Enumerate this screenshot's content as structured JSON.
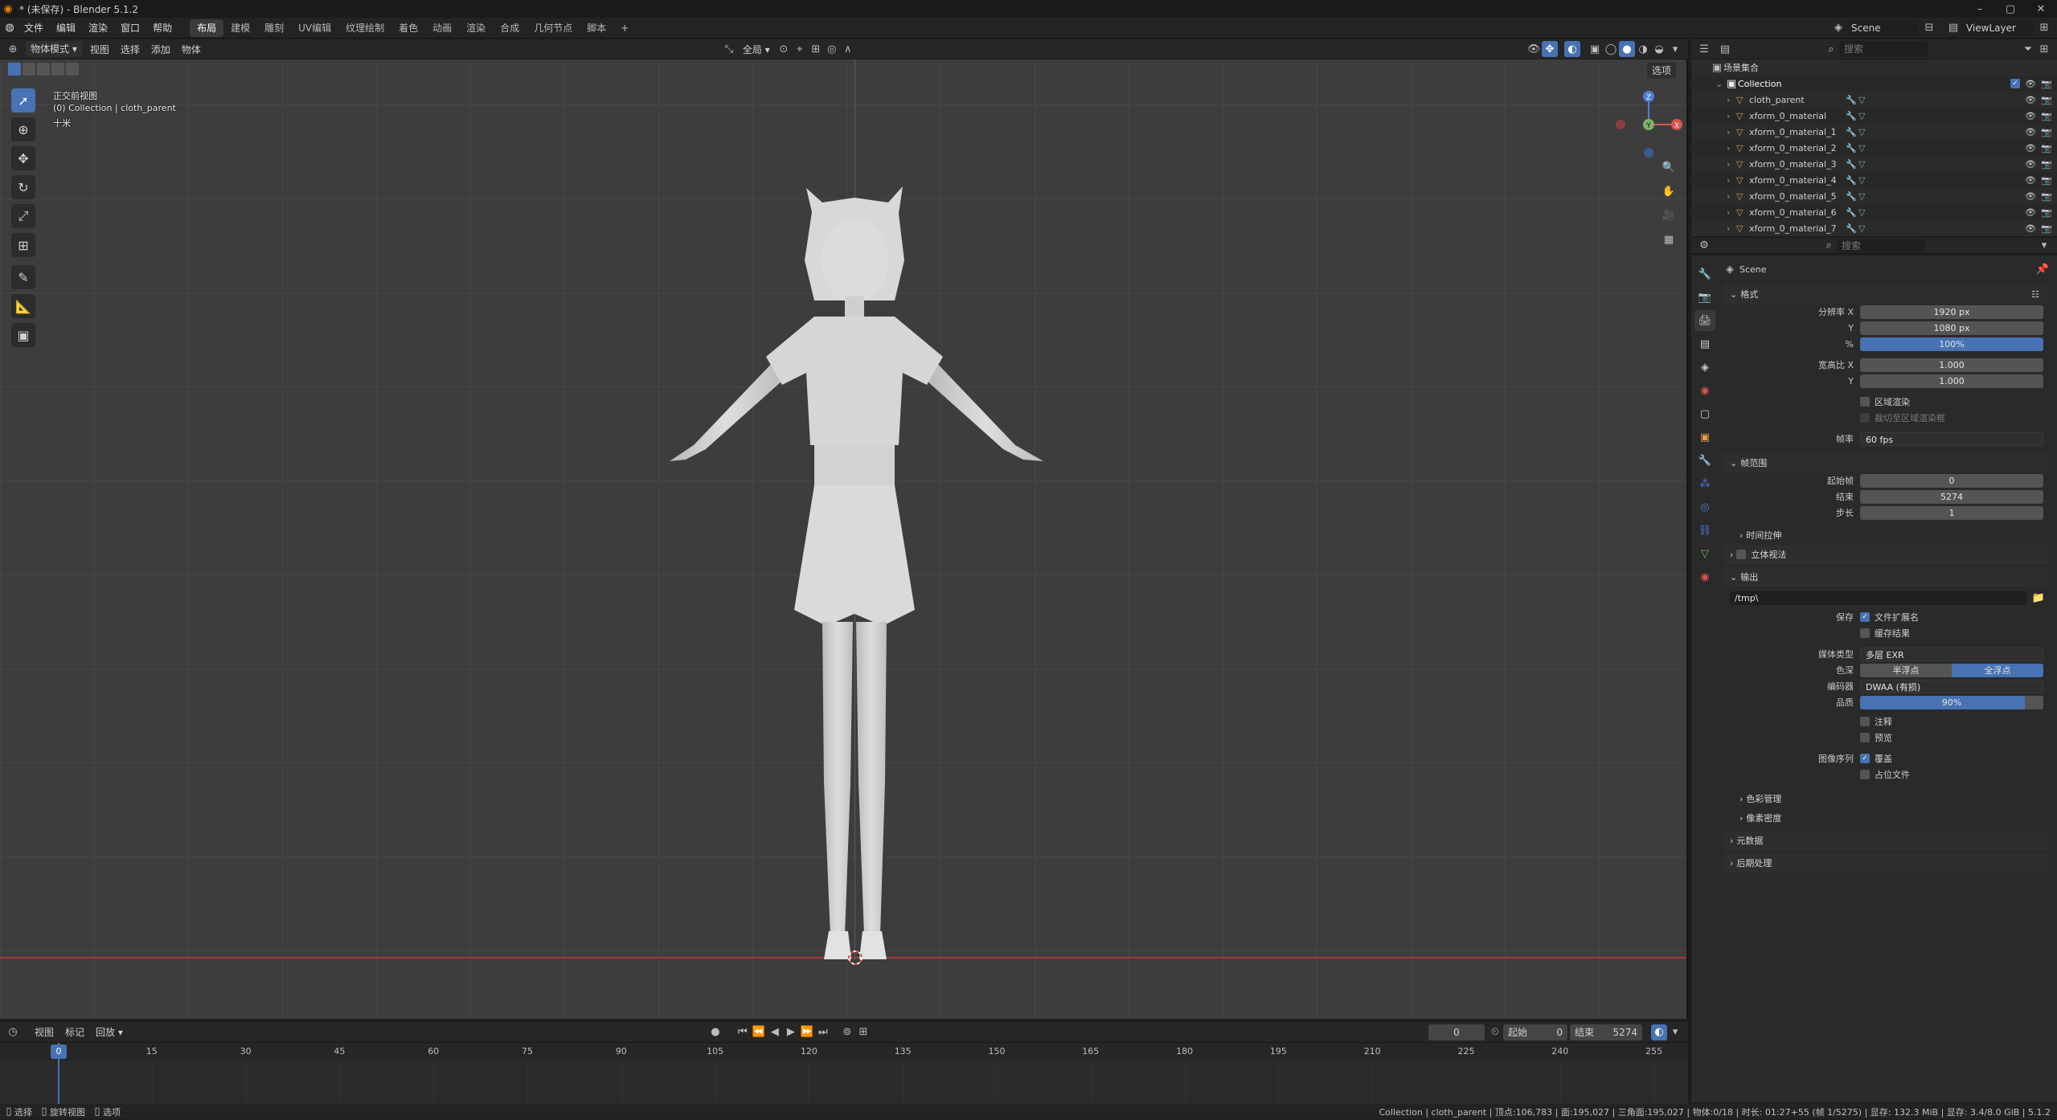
{
  "window": {
    "title": "* (未保存) - Blender 5.1.2"
  },
  "menu": [
    "文件",
    "编辑",
    "渲染",
    "窗口",
    "帮助"
  ],
  "workspaces": [
    {
      "label": "布局",
      "active": true
    },
    {
      "label": "建模"
    },
    {
      "label": "雕刻"
    },
    {
      "label": "UV编辑"
    },
    {
      "label": "纹理绘制"
    },
    {
      "label": "着色"
    },
    {
      "label": "动画"
    },
    {
      "label": "渲染"
    },
    {
      "label": "合成"
    },
    {
      "label": "几何节点"
    },
    {
      "label": "脚本"
    },
    {
      "label": "+"
    }
  ],
  "scene": {
    "label": "Scene",
    "viewlayer": "ViewLayer"
  },
  "viewport_header": {
    "mode": "物体模式",
    "items": [
      "视图",
      "选择",
      "添加",
      "物体"
    ],
    "transform": "全局",
    "options": "选项"
  },
  "viewport_overlay": {
    "view": "正交前视图",
    "collection": "(0) Collection | cloth_parent",
    "scale": "十米"
  },
  "outliner": {
    "search_placeholder": "搜索",
    "root": "场景集合",
    "collection": "Collection",
    "items": [
      "cloth_parent",
      "xform_0_material",
      "xform_0_material_1",
      "xform_0_material_2",
      "xform_0_material_3",
      "xform_0_material_4",
      "xform_0_material_5",
      "xform_0_material_6",
      "xform_0_material_7"
    ]
  },
  "properties": {
    "search_placeholder": "搜索",
    "context": "Scene",
    "format": {
      "title": "格式",
      "res_x_label": "分辨率 X",
      "res_x": "1920 px",
      "res_y_label": "Y",
      "res_y": "1080 px",
      "pct_label": "%",
      "pct": "100%",
      "aspect_x_label": "宽高比 X",
      "aspect_x": "1.000",
      "aspect_y_label": "Y",
      "aspect_y": "1.000",
      "region_render": "区域渲染",
      "crop_region": "裁切至区域渲染框",
      "fps_label": "帧率",
      "fps": "60 fps"
    },
    "frame_range": {
      "title": "帧范围",
      "start_label": "起始帧",
      "start": "0",
      "end_label": "结束",
      "end": "5274",
      "step_label": "步长",
      "step": "1",
      "time_stretch": "时间拉伸",
      "stereo": "立体视法"
    },
    "output": {
      "title": "输出",
      "path": "/tmp\\",
      "save_label": "保存",
      "file_ext": "文件扩展名",
      "cache_result": "缓存结果",
      "media_label": "媒体类型",
      "media": "多层 EXR",
      "depth_label": "色深",
      "half": "半浮点",
      "full": "全浮点",
      "codec_label": "编码器",
      "codec": "DWAA (有损)",
      "quality_label": "品质",
      "quality": "90%",
      "notes": "注释",
      "preview": "预览",
      "sequence_label": "图像序列",
      "overwrite": "覆盖",
      "placeholders": "占位文件",
      "color_mgmt": "色彩管理",
      "pixel_density": "像素密度"
    },
    "metadata": "元数据",
    "postprocess": "后期处理"
  },
  "timeline": {
    "items": [
      "视图",
      "标记",
      "回放"
    ],
    "current": "0",
    "start_label": "起始",
    "start": "0",
    "end_label": "结束",
    "end": "5274",
    "ticks": [
      "0",
      "15",
      "30",
      "45",
      "60",
      "75",
      "90",
      "105",
      "120",
      "135",
      "150",
      "165",
      "180",
      "195",
      "210",
      "225",
      "240",
      "255"
    ],
    "playhead_frame": 0
  },
  "statusbar": {
    "left": [
      "选择",
      "旋转视图",
      "选项"
    ],
    "right": "Collection | cloth_parent | 顶点:106,783 | 面:195,027 | 三角面:195,027 | 物体:0/18 | 时长: 01:27+55 (帧 1/5275) | 显存: 132.3 MiB | 显存: 3.4/8.0 GiB | 5.1.2"
  },
  "colors": {
    "accent": "#4772b3",
    "selected_text": "#ffffff",
    "object_orange": "#e89a46",
    "mesh_green": "#7ab26a"
  }
}
